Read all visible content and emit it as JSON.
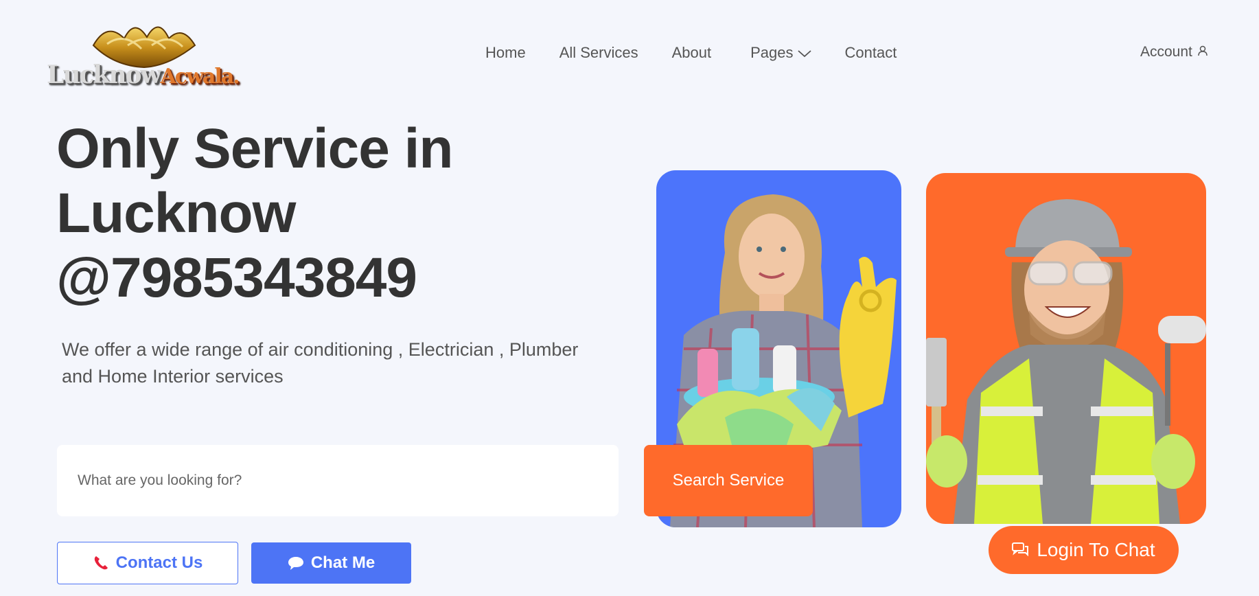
{
  "brand": {
    "logo_text_part1": "Lucknow",
    "logo_text_part2": "Acwala."
  },
  "nav": {
    "items": [
      {
        "label": "Home"
      },
      {
        "label": "All Services"
      },
      {
        "label": "About"
      },
      {
        "label": "Pages"
      },
      {
        "label": "Contact"
      }
    ],
    "account_label": "Account"
  },
  "hero": {
    "title_line1": "Only Service in",
    "title_line2": "Lucknow",
    "title_line3": "@7985343849",
    "subtitle": "We offer a wide range of air conditioning , Electrician , Plumber and Home Interior services"
  },
  "search": {
    "placeholder": "What are you looking for?",
    "button_label": "Search Service"
  },
  "actions": {
    "contact_label": "Contact Us",
    "chat_label": "Chat Me",
    "login_chat_label": "Login To Chat"
  },
  "colors": {
    "accent_orange": "#ff6a2b",
    "accent_blue": "#4d74f5",
    "background": "#f4f6fc",
    "heading": "#333333"
  },
  "icons": {
    "nav_pages": "chevron-down-icon",
    "account": "user-icon",
    "contact": "phone-icon",
    "chat": "chat-bubble-icon",
    "login_chat": "chat-bubbles-icon"
  }
}
